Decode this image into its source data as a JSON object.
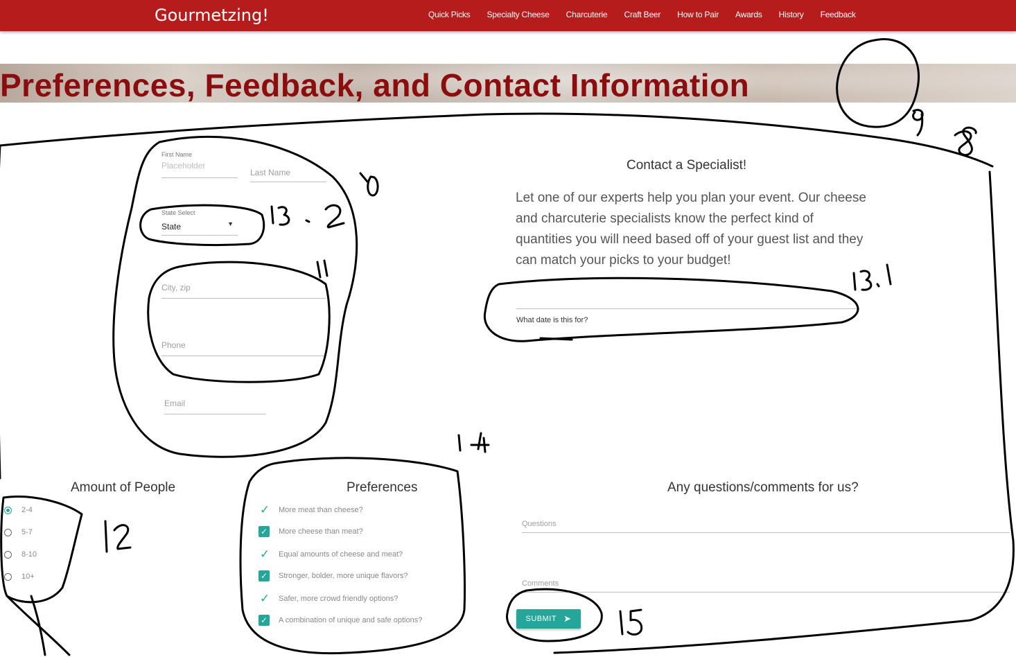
{
  "brand": "Gourmetzing!",
  "nav": [
    "Quick Picks",
    "Specialty Cheese",
    "Charcuterie",
    "Craft Beer",
    "How to Pair",
    "Awards",
    "History",
    "Feedback"
  ],
  "banner_title": "Preferences, Feedback, and Contact Information",
  "form": {
    "first_name_label": "First Name",
    "first_name_placeholder": "Placeholder",
    "last_name_placeholder": "Last Name",
    "state_label": "State Select",
    "state_value": "State",
    "city_zip_placeholder": "City, zip",
    "phone_placeholder": "Phone",
    "email_placeholder": "Email"
  },
  "contact": {
    "title": "Contact a Specialist!",
    "text": "Let one of our experts help you plan your event. Our cheese and charcuterie specialists know the perfect kind of quantities you will need based off of your guest list and they can match your picks to your budget!",
    "date_label": "What date is this for?"
  },
  "people": {
    "title": "Amount of People",
    "options": [
      "2-4",
      "5-7",
      "8-10",
      "10+"
    ],
    "selected": "2-4"
  },
  "preferences": {
    "title": "Preferences",
    "items": [
      {
        "label": "More meat than cheese?",
        "checked": false
      },
      {
        "label": "More cheese than meat?",
        "checked": true
      },
      {
        "label": "Equal amounts of cheese and meat?",
        "checked": false
      },
      {
        "label": "Stronger, bolder, more unique flavors?",
        "checked": true
      },
      {
        "label": "Safer, more crowd friendly options?",
        "checked": false
      },
      {
        "label": "A combination of unique and safe options?",
        "checked": true
      }
    ]
  },
  "questions": {
    "title": "Any questions/comments for us?",
    "questions_placeholder": "Questions",
    "comments_placeholder": "Comments",
    "submit_label": "SUBMIT"
  },
  "annotations": [
    "8",
    "9",
    "10",
    "11",
    "12",
    "13.1",
    "13.2",
    "14",
    "15"
  ],
  "colors": {
    "nav": "#b71c1c",
    "banner_text": "#8b0d0d",
    "accent": "#26a69a"
  }
}
